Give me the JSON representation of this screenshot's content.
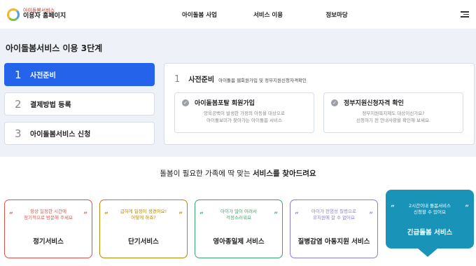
{
  "header": {
    "logo_sub": "아이돌봄서비스",
    "logo_main": "이용자 홈페이지",
    "nav": [
      "아이돌봄 사업",
      "서비스 이용",
      "정보마당"
    ]
  },
  "page": {
    "title": "아이돌봄서비스 이용 3단계"
  },
  "steps": [
    {
      "num": "1",
      "label": "사전준비",
      "active": true
    },
    {
      "num": "2",
      "label": "결제방법 등록",
      "active": false
    },
    {
      "num": "3",
      "label": "아이돌봄서비스 신청",
      "active": false
    }
  ],
  "panel": {
    "num": "1",
    "title": "사전준비",
    "desc": "아이돌봄 웹회원가입 및 정부지원신청자격확인",
    "cards": [
      {
        "title": "아이돌봄포탈 회원가입",
        "line1": "양육공백이 발생한 가정의 아동을 대상으로",
        "line2": "아이돌보미가 찾아가는 아이돌봄 서비스"
      },
      {
        "title": "정부지원신청자격 확인",
        "line1": "정부지원복지제도 대상이신가요?",
        "line2": "신청하기 전 안내사항을 확인해 보세요."
      }
    ]
  },
  "headline": {
    "pre": "돌봄이 필요한 가족에 딱 맞는 ",
    "bold": "서비스를 찾아드려요"
  },
  "services": [
    {
      "line1": "항상 일정한 시간에",
      "line2": "정기적으로 방문해 주세요",
      "name": "정기서비스",
      "color": "#d9534f"
    },
    {
      "line1": "급하게 일정이 생겼어요!",
      "line2": "어떻게 하죠?",
      "name": "단기서비스",
      "color": "#b8860b"
    },
    {
      "line1": "아이가 많이 어려서",
      "line2": "걱정스러워요",
      "name": "영아종일제 서비스",
      "color": "#3aa56b"
    },
    {
      "line1": "아이가 전염성 질병으로",
      "line2": "유치원에 갈 수 없어요",
      "name": "질병감염 아동지원 서비스",
      "color": "#8a7fd1"
    },
    {
      "line1": "2시간이내 돌봄서비스",
      "line2": "신청할 수 있어요",
      "name": "긴급돌봄 서비스",
      "color": "#1a93b9"
    }
  ]
}
